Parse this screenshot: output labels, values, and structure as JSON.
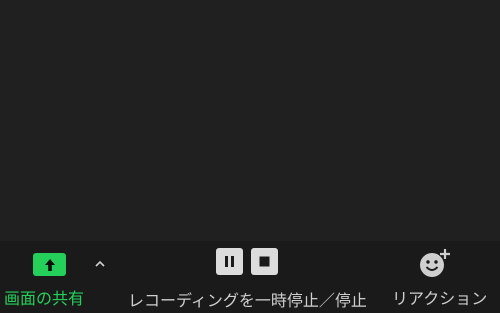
{
  "toolbar": {
    "share": {
      "label": "画面の共有",
      "accent_color": "#24d05a",
      "icon": "arrow-up-icon",
      "caret_icon": "chevron-up-icon"
    },
    "recording": {
      "label": "レコーディングを一時停止／停止",
      "pause_icon": "pause-icon",
      "stop_icon": "stop-icon"
    },
    "reactions": {
      "label": "リアクション",
      "icon": "smiley-plus-icon"
    }
  }
}
